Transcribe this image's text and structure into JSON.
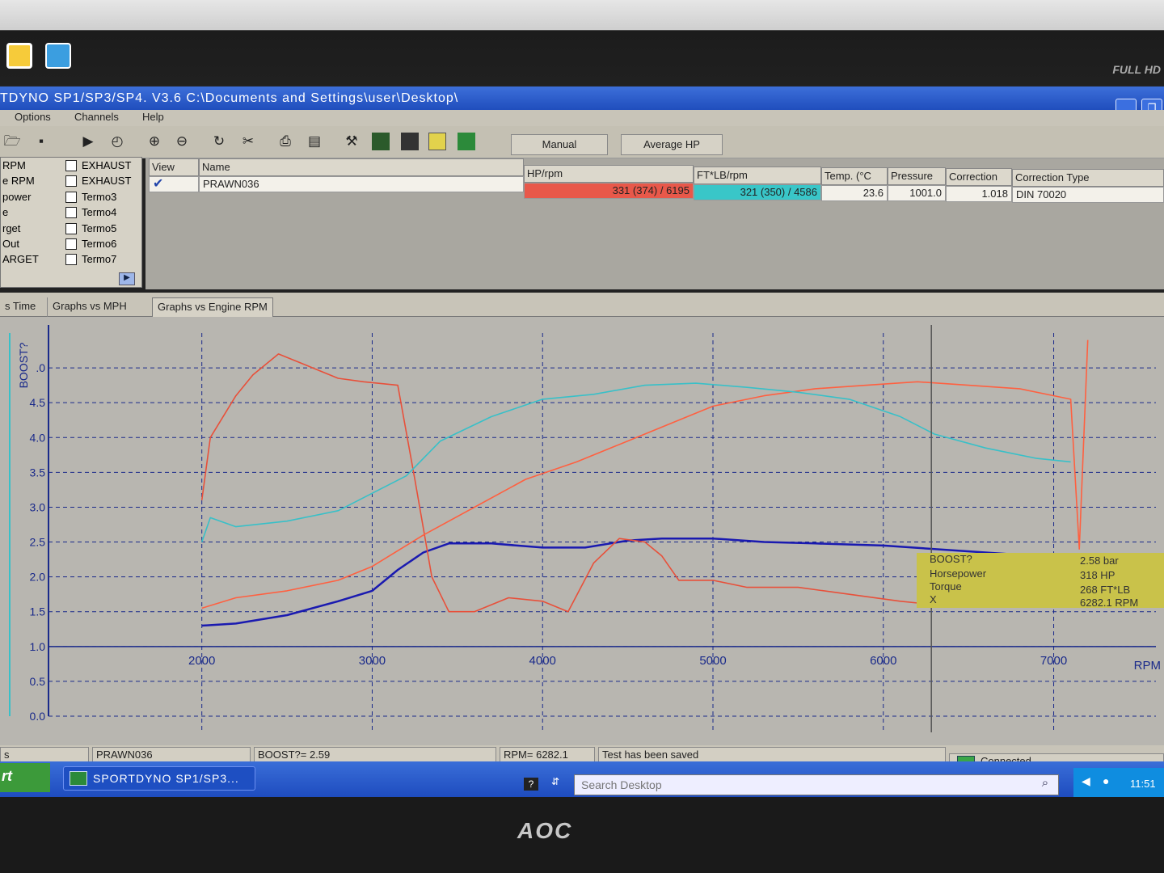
{
  "window": {
    "title": "TDYNO SP1/SP3/SP4. V3.6  C:\\Documents and Settings\\user\\Desktop\\",
    "brand_label": "FULL HD",
    "monitor_brand": "AOC"
  },
  "menu": [
    "Options",
    "Channels",
    "Help"
  ],
  "toolbar": {
    "manual_label": "Manual",
    "average_hp_label": "Average HP"
  },
  "channels": {
    "left": [
      "RPM",
      "e RPM",
      "power",
      "e",
      "rget",
      "Out",
      "ARGET"
    ],
    "right": [
      "EXHAUST",
      "EXHAUST",
      "Termo3",
      "Termo4",
      "Termo5",
      "Termo6",
      "Termo7"
    ]
  },
  "results_table": {
    "headers": [
      "View",
      "Name",
      "HP/rpm",
      "FT*LB/rpm",
      "Temp. (°C",
      "Pressure",
      "Correction",
      "Correction Type"
    ],
    "row": {
      "name": "PRAWN036",
      "hp": "331 (374) / 6195",
      "torque": "321 (350) / 4586",
      "temp": "23.6",
      "pressure": "1001.0",
      "correction": "1.018",
      "correction_type": "DIN 70020"
    }
  },
  "tabs": [
    "s Time",
    "Graphs vs MPH",
    "Graphs vs Engine RPM"
  ],
  "tooltip": {
    "rows": [
      {
        "label": "BOOST?",
        "value": "2.58 bar"
      },
      {
        "label": "Horsepower",
        "value": "318 HP"
      },
      {
        "label": "Torque",
        "value": "268 FT*LB"
      },
      {
        "label": "X",
        "value": "6282.1 RPM"
      }
    ]
  },
  "status": {
    "left": "s",
    "name": "PRAWN036",
    "boost": "BOOST?= 2.59",
    "rpm": "RPM= 6282.1",
    "message": "Test has been saved",
    "connection": "Connected"
  },
  "taskbar": {
    "start_label": "rt",
    "task_label": "SPORTDYNO SP1/SP3...",
    "search_placeholder": "Search Desktop",
    "clock": "11:51"
  },
  "chart_data": {
    "type": "line",
    "xlabel": "RPM",
    "ylabel": "BOOST?",
    "xlim": [
      1100,
      7600
    ],
    "ylim": [
      0,
      5.5
    ],
    "x_ticks": [
      2000,
      3000,
      4000,
      5000,
      6000,
      7000
    ],
    "y_ticks": [
      0.0,
      0.5,
      1.0,
      1.5,
      2.0,
      2.5,
      3.0,
      3.5,
      4.0,
      4.5,
      5.0
    ],
    "y_tick_labels": [
      "0.0",
      "0.5",
      "1.0",
      "1.5",
      "2.0",
      "2.5",
      "3.0",
      "3.5",
      "4.0",
      "4.5",
      ".0"
    ],
    "grid": true,
    "cursor_x": 6282,
    "series": [
      {
        "color": "#1a1ab0",
        "points": [
          [
            2000,
            1.3
          ],
          [
            2200,
            1.33
          ],
          [
            2500,
            1.45
          ],
          [
            2800,
            1.65
          ],
          [
            3000,
            1.8
          ],
          [
            3150,
            2.1
          ],
          [
            3300,
            2.35
          ],
          [
            3450,
            2.48
          ],
          [
            3700,
            2.48
          ],
          [
            4000,
            2.42
          ],
          [
            4250,
            2.42
          ],
          [
            4500,
            2.52
          ],
          [
            4700,
            2.55
          ],
          [
            5000,
            2.55
          ],
          [
            5300,
            2.5
          ],
          [
            5600,
            2.48
          ],
          [
            6000,
            2.45
          ],
          [
            6300,
            2.4
          ],
          [
            6600,
            2.35
          ],
          [
            6900,
            2.3
          ],
          [
            7100,
            2.28
          ]
        ]
      },
      {
        "color": "#e8503a",
        "points": [
          [
            2000,
            3.1
          ],
          [
            2050,
            4.0
          ],
          [
            2200,
            4.6
          ],
          [
            2300,
            4.9
          ],
          [
            2450,
            5.2
          ],
          [
            2600,
            5.05
          ],
          [
            2800,
            4.85
          ],
          [
            2950,
            4.8
          ],
          [
            3150,
            4.75
          ],
          [
            3250,
            3.4
          ],
          [
            3350,
            2.0
          ],
          [
            3450,
            1.5
          ],
          [
            3600,
            1.5
          ],
          [
            3800,
            1.7
          ],
          [
            4000,
            1.65
          ],
          [
            4150,
            1.5
          ],
          [
            4300,
            2.2
          ],
          [
            4450,
            2.55
          ],
          [
            4600,
            2.5
          ],
          [
            4700,
            2.3
          ],
          [
            4800,
            1.95
          ],
          [
            5000,
            1.95
          ],
          [
            5200,
            1.85
          ],
          [
            5500,
            1.85
          ],
          [
            5800,
            1.75
          ],
          [
            6100,
            1.65
          ],
          [
            6300,
            1.6
          ]
        ]
      },
      {
        "color": "#ff6040",
        "points": [
          [
            2000,
            1.55
          ],
          [
            2200,
            1.7
          ],
          [
            2500,
            1.8
          ],
          [
            2800,
            1.95
          ],
          [
            3000,
            2.15
          ],
          [
            3300,
            2.6
          ],
          [
            3600,
            3.0
          ],
          [
            3900,
            3.4
          ],
          [
            4200,
            3.65
          ],
          [
            4500,
            3.95
          ],
          [
            4800,
            4.25
          ],
          [
            5000,
            4.45
          ],
          [
            5300,
            4.6
          ],
          [
            5600,
            4.7
          ],
          [
            5900,
            4.75
          ],
          [
            6200,
            4.8
          ],
          [
            6500,
            4.75
          ],
          [
            6800,
            4.7
          ],
          [
            7100,
            4.55
          ],
          [
            7150,
            2.4
          ],
          [
            7200,
            5.4
          ]
        ]
      },
      {
        "color": "#38c0c8",
        "points": [
          [
            2000,
            2.5
          ],
          [
            2050,
            2.85
          ],
          [
            2200,
            2.72
          ],
          [
            2500,
            2.8
          ],
          [
            2800,
            2.95
          ],
          [
            3000,
            3.2
          ],
          [
            3200,
            3.45
          ],
          [
            3400,
            3.95
          ],
          [
            3700,
            4.3
          ],
          [
            4000,
            4.55
          ],
          [
            4300,
            4.62
          ],
          [
            4600,
            4.75
          ],
          [
            4900,
            4.78
          ],
          [
            5200,
            4.72
          ],
          [
            5500,
            4.65
          ],
          [
            5800,
            4.55
          ],
          [
            6100,
            4.3
          ],
          [
            6300,
            4.05
          ],
          [
            6600,
            3.85
          ],
          [
            6900,
            3.7
          ],
          [
            7100,
            3.65
          ]
        ]
      }
    ]
  }
}
